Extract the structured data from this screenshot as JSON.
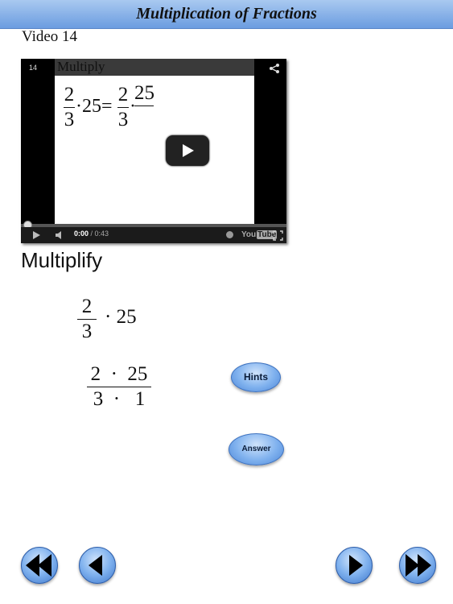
{
  "header": {
    "title": "Multiplication of Fractions"
  },
  "video": {
    "label": "Video 14",
    "number": "14",
    "frame_title": "Multiply",
    "frame_formula": {
      "left_num": "2",
      "left_den": "3",
      "times_value": "·25=",
      "right_num": "2",
      "right_den": "3",
      "right_num2": "25"
    },
    "time_current": "0:00",
    "time_total": " / 0:43",
    "youtube_label": "You",
    "youtube_tube": "Tube",
    "progress": 0
  },
  "problem": {
    "heading": "Multiplify",
    "step1": {
      "num": "2",
      "den": "3",
      "rest": "· 25"
    },
    "step2": {
      "num": "2  ·  25",
      "den": "3  ·   1"
    }
  },
  "buttons": {
    "hints": "Hints",
    "answer": "Answer"
  },
  "icons": {
    "share": "share-icon",
    "play": "play-icon",
    "volume": "volume-icon",
    "info": "info-icon",
    "fullscreen": "fullscreen-icon",
    "first": "first-page-icon",
    "prev": "previous-page-icon",
    "next": "next-page-icon",
    "last": "last-page-icon"
  },
  "colors": {
    "header_top": "#a9c9f0",
    "header_bottom": "#6b9ce0",
    "button_blue": "#7fb1ee"
  }
}
